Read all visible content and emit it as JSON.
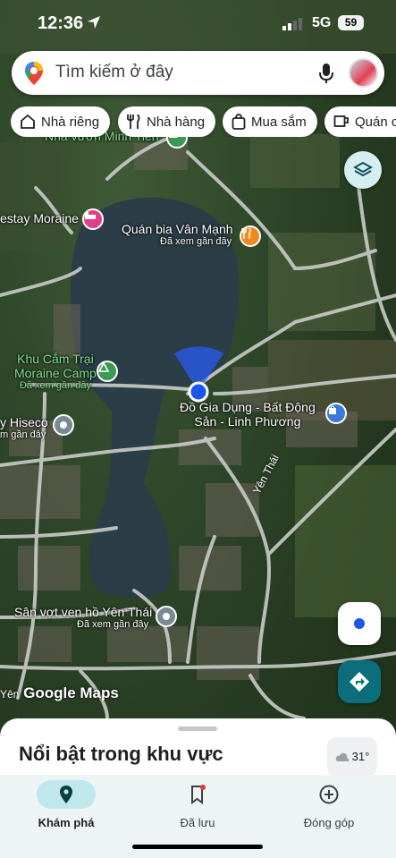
{
  "status_bar": {
    "time": "12:36",
    "network": "5G",
    "battery": "59"
  },
  "search": {
    "placeholder": "Tìm kiếm ở đây"
  },
  "chips": [
    {
      "label": "Nhà riêng",
      "icon": "home-icon"
    },
    {
      "label": "Nhà hàng",
      "icon": "restaurant-icon"
    },
    {
      "label": "Mua sắm",
      "icon": "shopping-bag-icon"
    },
    {
      "label": "Quán c",
      "icon": "coffee-icon"
    }
  ],
  "map": {
    "places": {
      "top_label": "Nhà vườn Minh Tiến",
      "homestay": "estay Moraine",
      "bia": {
        "name": "Quán bia Vân Mạnh",
        "sub": "Đã xem gần đây"
      },
      "camp": {
        "name_line1": "Khu Cắm Trại",
        "name_line2": "Moraine Camp",
        "sub": "Đã xem gần đây"
      },
      "hiseco": {
        "name": "y Hiseco",
        "sub": "m gần đây"
      },
      "giadung": {
        "line1": "Đồ Gia Dụng - Bất Động",
        "line2": "Sản - Linh Phương"
      },
      "sanvot": {
        "name": "Sân vợt ven hồ Yên Thái",
        "sub": "Đã xem gần đây"
      }
    },
    "road_label": "Yên Thái",
    "watermark_left": "Yên",
    "watermark_brand": "Google Maps",
    "colors": {
      "water": "#2b3d47",
      "road": "#c9ccc9",
      "accent": "#0b6e7c",
      "location": "#1a56e8"
    }
  },
  "sheet": {
    "title": "Nổi bật trong khu vực",
    "weather": "31°"
  },
  "nav": [
    {
      "label": "Khám phá",
      "icon": "explore-pin-icon",
      "active": true
    },
    {
      "label": "Đã lưu",
      "icon": "bookmark-icon",
      "active": false
    },
    {
      "label": "Đóng góp",
      "icon": "add-circle-icon",
      "active": false
    }
  ]
}
